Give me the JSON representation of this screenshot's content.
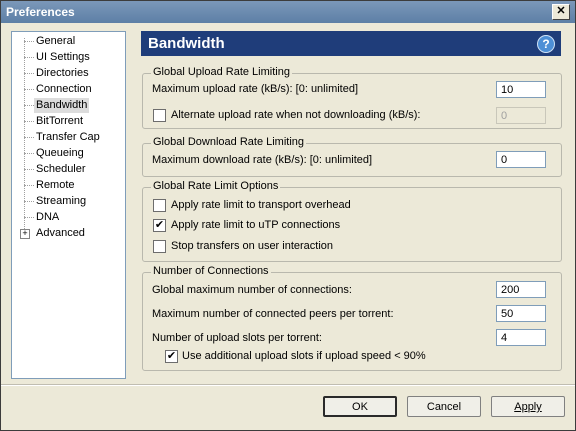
{
  "window": {
    "title": "Preferences"
  },
  "tree": {
    "items": [
      {
        "label": "General"
      },
      {
        "label": "UI Settings"
      },
      {
        "label": "Directories"
      },
      {
        "label": "Connection"
      },
      {
        "label": "Bandwidth",
        "selected": true
      },
      {
        "label": "BitTorrent"
      },
      {
        "label": "Transfer Cap"
      },
      {
        "label": "Queueing"
      },
      {
        "label": "Scheduler"
      },
      {
        "label": "Remote"
      },
      {
        "label": "Streaming"
      },
      {
        "label": "DNA"
      },
      {
        "label": "Advanced",
        "expandable": true
      }
    ]
  },
  "header": {
    "title": "Bandwidth",
    "help_icon": "help-icon"
  },
  "upload": {
    "group_title": "Global Upload Rate Limiting",
    "max_label": "Maximum upload rate (kB/s): [0: unlimited]",
    "max_value": "10",
    "alt_label": "Alternate upload rate when not downloading (kB/s):",
    "alt_checked": false,
    "alt_value": "0"
  },
  "download": {
    "group_title": "Global Download Rate Limiting",
    "max_label": "Maximum download rate (kB/s): [0: unlimited]",
    "max_value": "0"
  },
  "options": {
    "group_title": "Global Rate Limit Options",
    "items": [
      {
        "label": "Apply rate limit to transport overhead",
        "checked": false
      },
      {
        "label": "Apply rate limit to uTP connections",
        "checked": true
      },
      {
        "label": "Stop transfers on user interaction",
        "checked": false
      }
    ]
  },
  "connections": {
    "group_title": "Number of Connections",
    "global_label": "Global maximum number of connections:",
    "global_value": "200",
    "peers_label": "Maximum number of connected peers per torrent:",
    "peers_value": "50",
    "slots_label": "Number of upload slots per torrent:",
    "slots_value": "4",
    "extra_label": "Use additional upload slots if upload speed < 90%",
    "extra_checked": true
  },
  "buttons": {
    "ok": "OK",
    "cancel": "Cancel",
    "apply": "Apply"
  },
  "colors": {
    "header_bg": "#1f3d7a",
    "title_bg": "#6a8ab0",
    "window_bg": "#ece9d8"
  }
}
